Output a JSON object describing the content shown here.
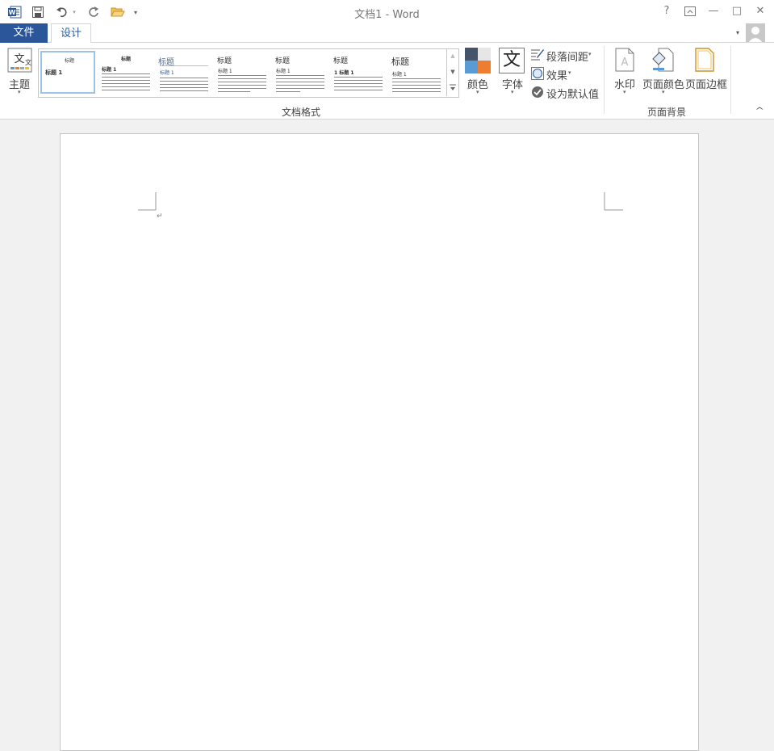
{
  "window": {
    "title": "文档1 - Word",
    "help_label": "?",
    "minimize_label": "—",
    "maximize_label": "□",
    "close_label": "✕"
  },
  "tabs": {
    "file": "文件",
    "design": "设计"
  },
  "ribbon": {
    "theme_label": "主题",
    "gallery_label": "文档格式",
    "gallery_items": [
      {
        "title": "标题",
        "heading": "标题 1"
      },
      {
        "title": "标题",
        "heading": "标题 1"
      },
      {
        "title": "标题",
        "heading": "标题 1"
      },
      {
        "title": "标题",
        "heading": "标题 1"
      },
      {
        "title": "标题",
        "heading": "标题 1"
      },
      {
        "title": "标题",
        "heading": "1 标题 1"
      },
      {
        "title": "标题",
        "heading": "标题 1"
      }
    ],
    "colors_label": "颜色",
    "fonts_label": "字体",
    "fonts_glyph": "文",
    "paragraph_spacing_label": "段落间距",
    "effects_label": "效果",
    "set_default_label": "设为默认值",
    "watermark_label": "水印",
    "page_color_label": "页面颜色",
    "page_borders_label": "页面边框",
    "page_background_label": "页面背景",
    "collapse_glyph": "^"
  },
  "document": {
    "paragraph_mark": "↵"
  },
  "colors": {
    "accent": "#2b579a",
    "theme_dark": "#44546a",
    "theme_light": "#e7e6e6",
    "theme_blue": "#5b9bd5",
    "theme_orange": "#ed7d31"
  }
}
